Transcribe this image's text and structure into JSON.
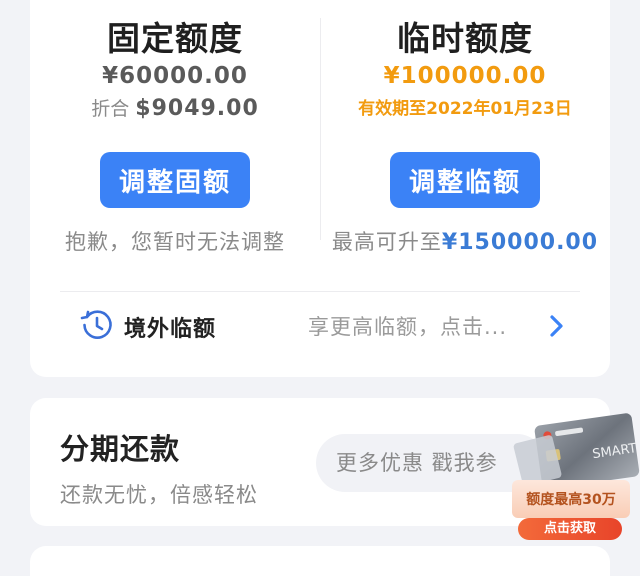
{
  "fixed": {
    "title": "固定额度",
    "amount": "¥60000.00",
    "discount_label": "折合",
    "discount_value": "$9049.00",
    "button": "调整固额",
    "note": "抱歉，您暂时无法调整"
  },
  "temp": {
    "title": "临时额度",
    "amount": "¥100000.00",
    "validity": "有效期至2022年01月23日",
    "button": "调整临额",
    "note_prefix": "最高可升至",
    "note_value": "¥150000.00"
  },
  "overseas": {
    "label": "境外临额",
    "hint": "享更高临额，点击..."
  },
  "installment": {
    "title": "分期还款",
    "subtitle": "还款无忧，倍感轻松",
    "pill": "更多优惠 戳我参",
    "promo_card_text": "SMART",
    "promo_ribbon": "额度最高30万",
    "promo_cta": "点击获取"
  },
  "colors": {
    "accent_blue": "#3b82f6",
    "orange": "#f29b0f",
    "highlight_blue": "#3a7bd5",
    "promo_red": "#e8442a"
  }
}
